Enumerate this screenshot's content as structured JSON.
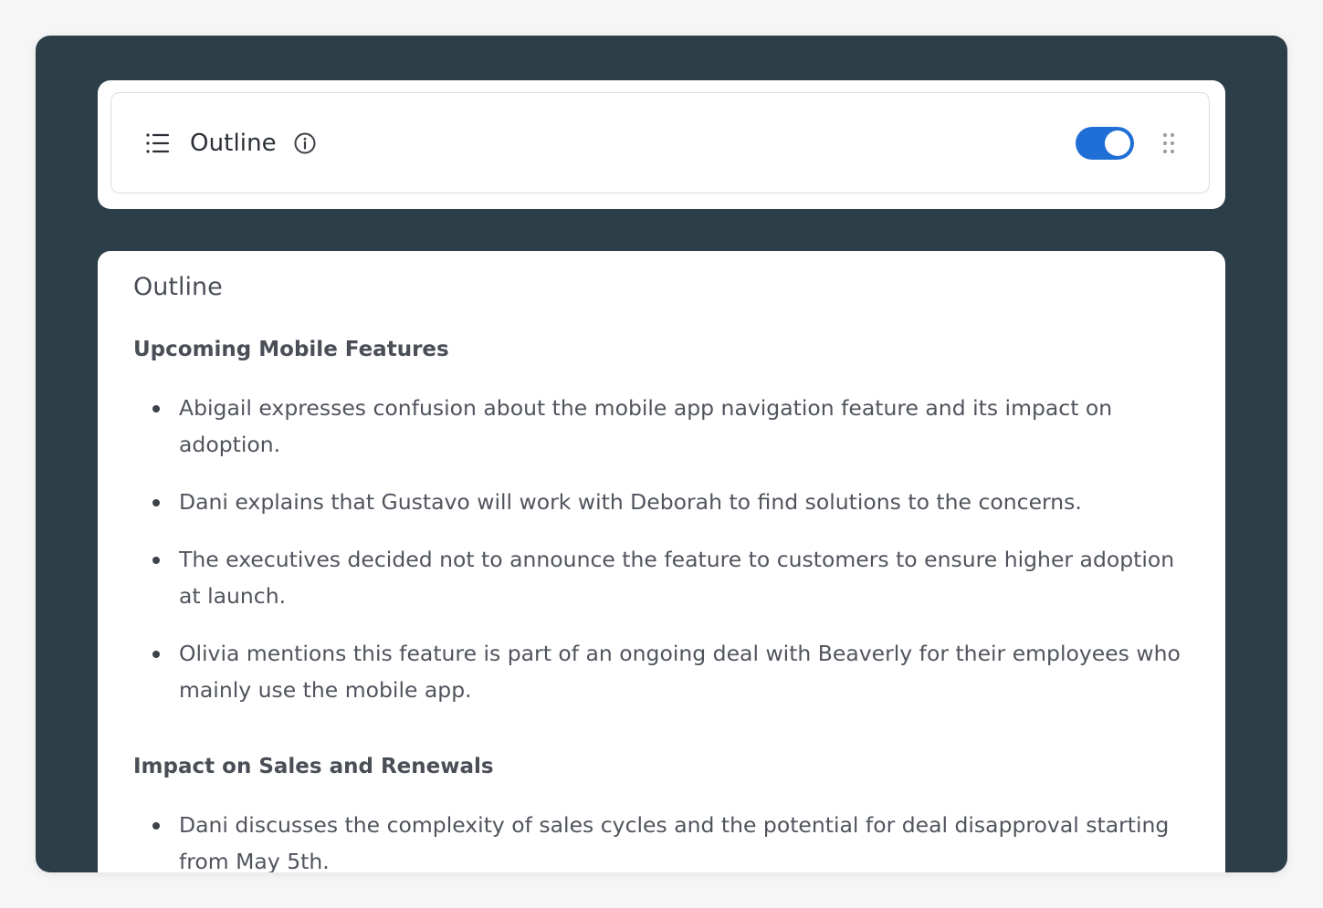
{
  "header": {
    "title": "Outline",
    "toggle_on": true,
    "accent_color": "#1f6fd6",
    "icons": {
      "list": "list-icon",
      "info": "info-icon",
      "drag": "drag-handle-icon"
    }
  },
  "content": {
    "title": "Outline",
    "sections": [
      {
        "title": "Upcoming Mobile Features",
        "bullets": [
          "Abigail expresses confusion about the mobile app navigation feature and its impact on adoption.",
          "Dani explains that Gustavo will work with Deborah to find solutions to the concerns.",
          "The executives decided not to announce the feature to customers to ensure higher adoption at launch.",
          "Olivia mentions this feature is part of an ongoing deal with Beaverly for their employees who mainly use the mobile app."
        ]
      },
      {
        "title": "Impact on Sales and Renewals",
        "bullets": [
          "Dani discusses the complexity of sales cycles and the potential for deal disapproval starting from May 5th."
        ]
      }
    ]
  }
}
